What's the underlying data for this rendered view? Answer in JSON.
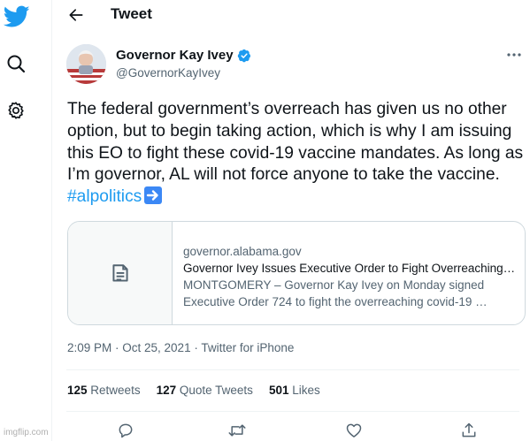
{
  "header": {
    "title": "Tweet"
  },
  "nav": {
    "logo_icon": "twitter-bird-icon",
    "search_icon": "search-icon",
    "settings_icon": "gear-icon"
  },
  "author": {
    "name": "Governor Kay Ivey",
    "handle": "@GovernorKayIvey",
    "verified": true
  },
  "tweet": {
    "text": "The federal government’s overreach has given us no other option, but to begin taking action, which is why I am issuing this EO to fight these covid-19 vaccine mandates. As long as I’m governor, AL will not force anyone to take the vaccine. ",
    "hashtag": "#alpolitics",
    "emoji": "right-arrow-emoji"
  },
  "card": {
    "domain": "governor.alabama.gov",
    "title": "Governor Ivey Issues Executive Order to Fight Overreaching…",
    "desc_line1": "MONTGOMERY – Governor Kay Ivey on Monday signed",
    "desc_line2": "Executive Order 724 to fight the overreaching covid-19 …",
    "thumb_icon": "document-icon"
  },
  "meta": {
    "text": "2:09 PM · Oct 25, 2021 · Twitter for iPhone"
  },
  "stats": {
    "retweets_count": "125",
    "retweets_label": "Retweets",
    "quotes_count": "127",
    "quotes_label": "Quote Tweets",
    "likes_count": "501",
    "likes_label": "Likes"
  },
  "colors": {
    "accent": "#1d9bf0",
    "text": "#0f1419",
    "secondary": "#536471",
    "border": "#cfd9de"
  },
  "watermark": "imgflip.com"
}
